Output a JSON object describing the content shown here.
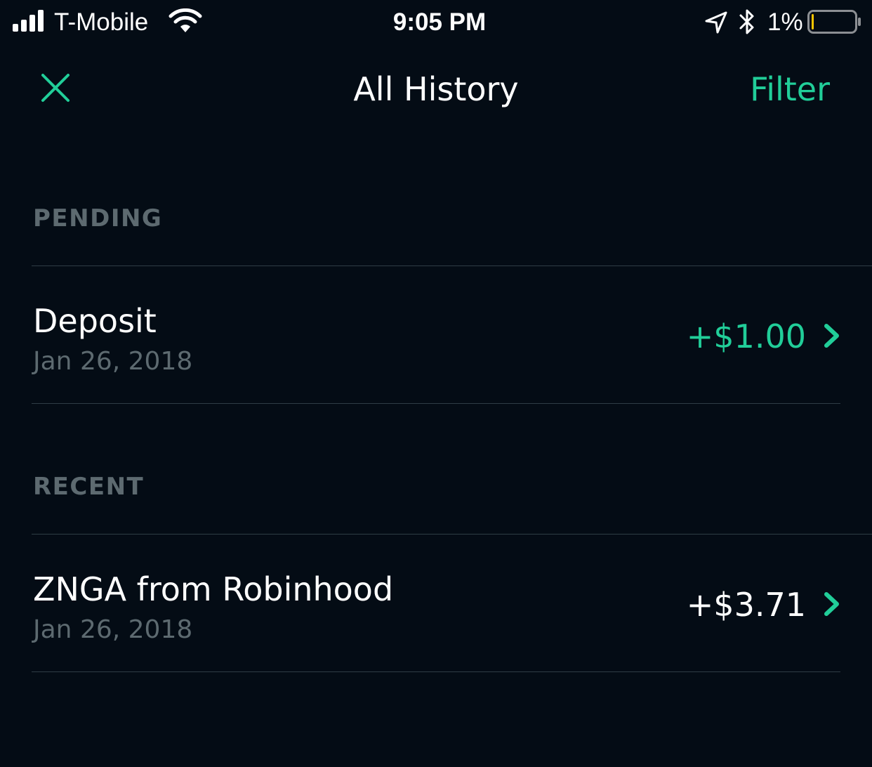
{
  "status_bar": {
    "carrier": "T-Mobile",
    "time": "9:05 PM",
    "battery_percent": "1%",
    "battery_level": 0.01,
    "icons": [
      "signal-bars-icon",
      "wifi-icon",
      "location-arrow-icon",
      "bluetooth-icon",
      "battery-icon"
    ]
  },
  "nav": {
    "close_icon": "close-icon",
    "title": "All History",
    "filter_label": "Filter"
  },
  "sections": {
    "pending": {
      "label": "PENDING",
      "items": [
        {
          "title": "Deposit",
          "date": "Jan 26, 2018",
          "amount": "+$1.00",
          "amount_color": "#21ce99"
        }
      ]
    },
    "recent": {
      "label": "RECENT",
      "items": [
        {
          "title": "ZNGA from Robinhood",
          "date": "Jan 26, 2018",
          "amount": "+$3.71",
          "amount_color": "#ffffff"
        }
      ]
    }
  },
  "colors": {
    "background": "#040c15",
    "accent": "#21ce99",
    "muted_text": "#5d6a70",
    "divider": "#2f3d45",
    "battery_low": "#ffc600"
  }
}
